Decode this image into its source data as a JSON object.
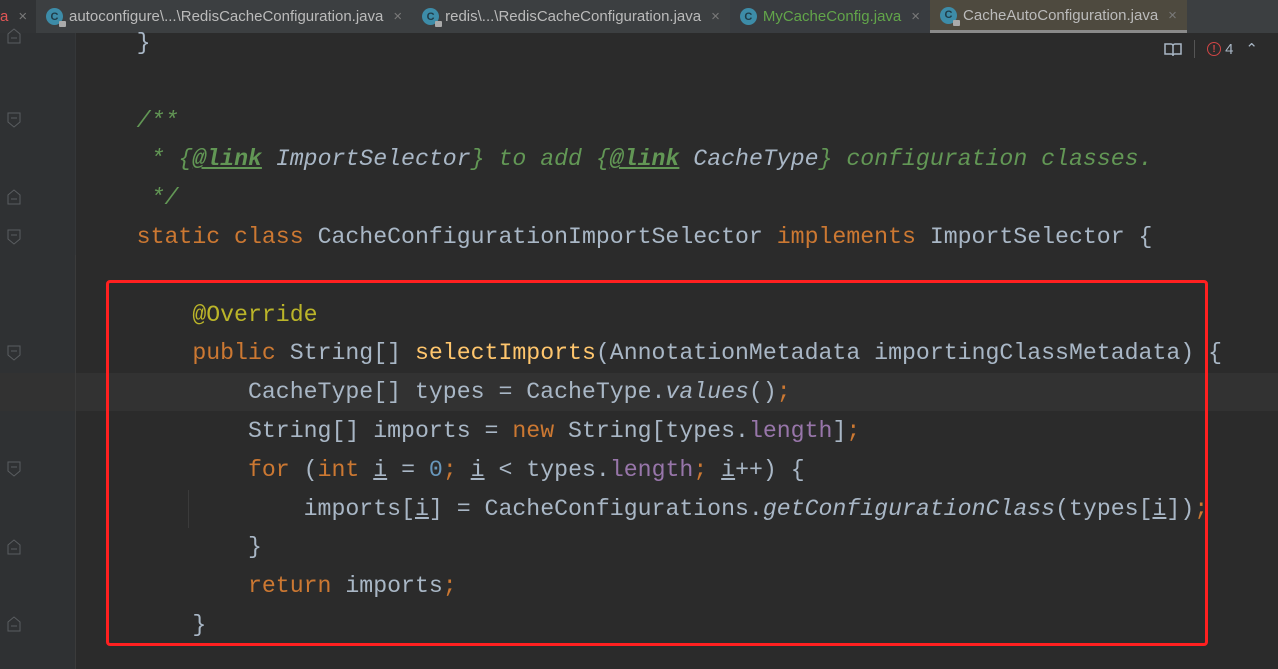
{
  "tabs": [
    {
      "label": "a",
      "kind": "partial"
    },
    {
      "label": "autoconfigure\\...\\RedisCacheConfiguration.java",
      "kind": "locked"
    },
    {
      "label": "redis\\...\\RedisCacheConfiguration.java",
      "kind": "locked"
    },
    {
      "label": "MyCacheConfig.java",
      "kind": "green"
    },
    {
      "label": "CacheAutoConfiguration.java",
      "kind": "active"
    }
  ],
  "close_glyph": "×",
  "class_icon_letter": "C",
  "status": {
    "reader_icon": "book-icon",
    "problems_count": "4",
    "error_glyph": "!",
    "expand_glyph": "⌃"
  },
  "colors": {
    "keyword": "#cc7832",
    "comment": "#629755",
    "annotation": "#bbb529",
    "method": "#ffc66d",
    "field": "#9876aa",
    "number": "#6897bb",
    "text": "#a9b7c6",
    "highlight_box": "#ff2020"
  },
  "code_lines": [
    [
      [
        "pl",
        "    }"
      ]
    ],
    [],
    [
      [
        "cm",
        "    /**"
      ]
    ],
    [
      [
        "cm",
        "     * {"
      ],
      [
        "cmtag",
        "@link"
      ],
      [
        "cmref",
        " ImportSelector"
      ],
      [
        "cm",
        "} to add {"
      ],
      [
        "cmtag",
        "@link"
      ],
      [
        "cmref",
        " CacheType"
      ],
      [
        "cm",
        "} configuration classes."
      ]
    ],
    [
      [
        "cm",
        "     */"
      ]
    ],
    [
      [
        "kw",
        "    static class "
      ],
      [
        "pl",
        "CacheConfigurationImportSelector "
      ],
      [
        "kw",
        "implements "
      ],
      [
        "pl",
        "ImportSelector {"
      ]
    ],
    [],
    [
      [
        "an",
        "        @Override"
      ]
    ],
    [
      [
        "kw",
        "        public "
      ],
      [
        "pl",
        "String[] "
      ],
      [
        "fn",
        "selectImports"
      ],
      [
        "pl",
        "(AnnotationMetadata importingClassMetadata) {"
      ]
    ],
    [
      [
        "pl",
        "            CacheType[] types = CacheType."
      ],
      [
        "st",
        "values"
      ],
      [
        "pl",
        "()"
      ],
      [
        "kw",
        ";"
      ]
    ],
    [
      [
        "pl",
        "            String[] imports = "
      ],
      [
        "kw",
        "new "
      ],
      [
        "pl",
        "String[types."
      ],
      [
        "fd",
        "length"
      ],
      [
        "pl",
        "]"
      ],
      [
        "kw",
        ";"
      ]
    ],
    [
      [
        "kw",
        "            for "
      ],
      [
        "pl",
        "("
      ],
      [
        "kw",
        "int "
      ],
      [
        "ul",
        "i"
      ],
      [
        "pl",
        " = "
      ],
      [
        "num",
        "0"
      ],
      [
        "kw",
        "; "
      ],
      [
        "ul",
        "i"
      ],
      [
        "pl",
        " < types."
      ],
      [
        "fd",
        "length"
      ],
      [
        "kw",
        "; "
      ],
      [
        "ul",
        "i"
      ],
      [
        "pl",
        "++) {"
      ]
    ],
    [
      [
        "pl",
        "                imports["
      ],
      [
        "ul",
        "i"
      ],
      [
        "pl",
        "] = CacheConfigurations."
      ],
      [
        "st",
        "getConfigurationClass"
      ],
      [
        "pl",
        "(types["
      ],
      [
        "ul",
        "i"
      ],
      [
        "pl",
        "])"
      ],
      [
        "kw",
        ";"
      ]
    ],
    [
      [
        "pl",
        "            }"
      ]
    ],
    [
      [
        "kw",
        "            return "
      ],
      [
        "pl",
        "imports"
      ],
      [
        "kw",
        ";"
      ]
    ],
    [
      [
        "pl",
        "        }"
      ]
    ]
  ]
}
